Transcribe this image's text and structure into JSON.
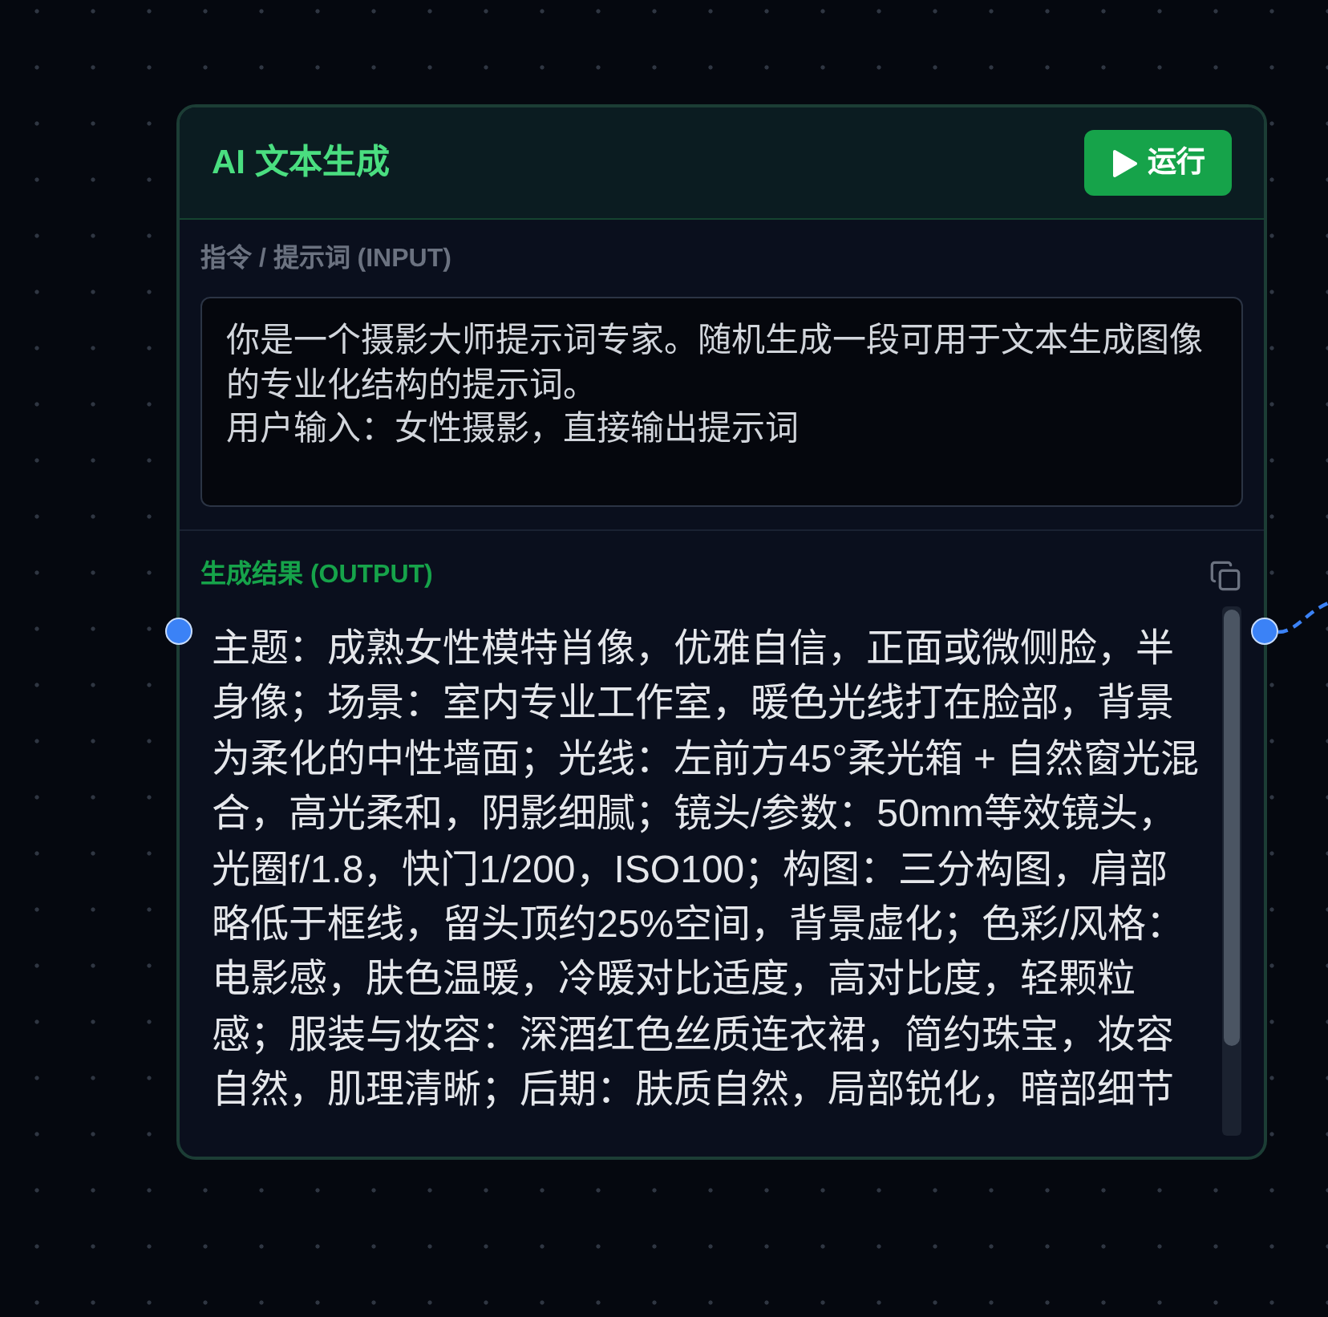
{
  "node": {
    "title": "AI 文本生成",
    "run_button": {
      "label": "运行"
    },
    "input": {
      "label": "指令 / 提示词 (INPUT)",
      "value_lines": [
        "你是一个摄影大师提示词专家。随机生成一段可用于文本生成图像的专业化结构的提示词。",
        "用户输入：女性摄影，直接输出提示词"
      ]
    },
    "output": {
      "label": "生成结果 (OUTPUT)",
      "text": "主题：成熟女性模特肖像，优雅自信，正面或微侧脸，半身像；场景：室内专业工作室，暖色光线打在脸部，背景为柔化的中性墙面；光线：左前方45°柔光箱 + 自然窗光混合，高光柔和，阴影细腻；镜头/参数：50mm等效镜头，光圈f/1.8，快门1/200，ISO100；构图：三分构图，肩部略低于框线，留头顶约25%空间，背景虚化；色彩/风格：电影感，肤色温暖，冷暖对比适度，高对比度，轻颗粒感；服装与妆容：深酒红色丝质连衣裙，简约珠宝，妆容自然，肌理清晰；后期：肤质自然，局部锐化，暗部细节"
    }
  }
}
